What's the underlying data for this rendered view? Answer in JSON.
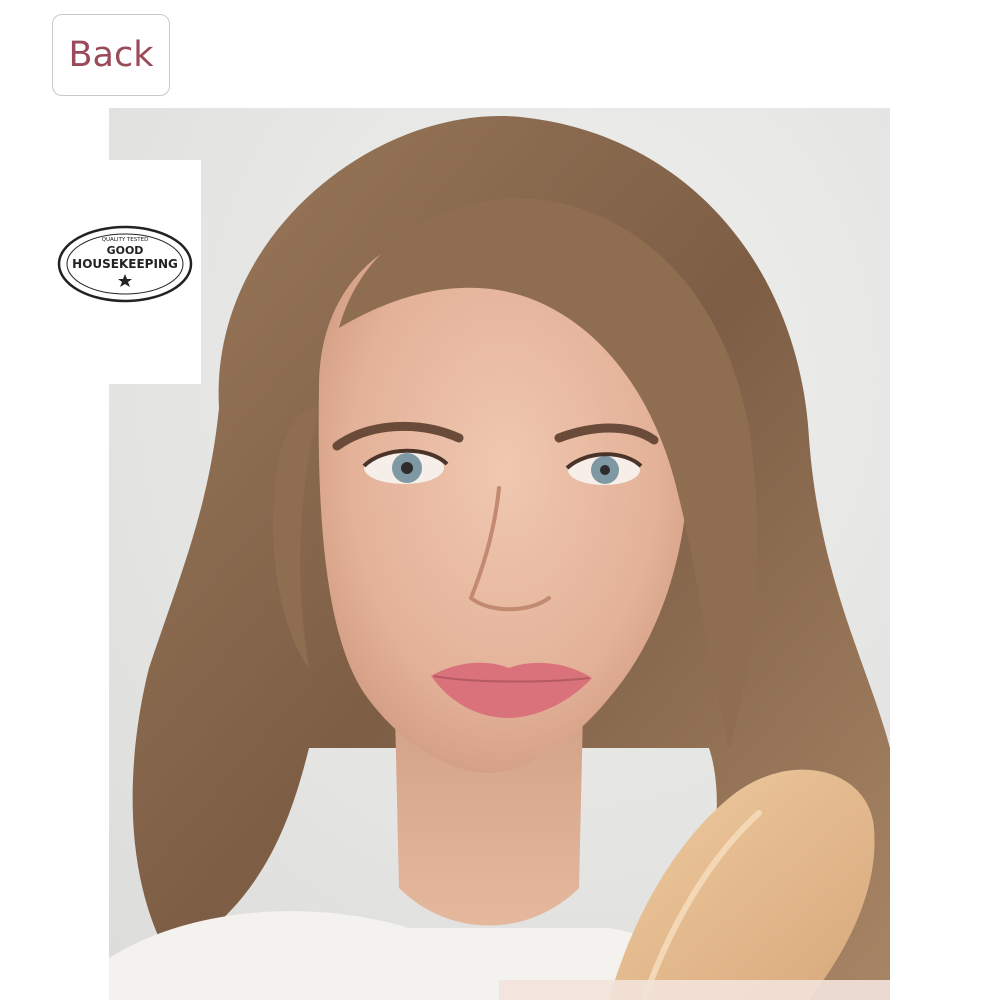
{
  "header": {
    "back_label": "Back"
  },
  "hero": {
    "subject": "model-portrait-with-foundation-swatch"
  },
  "badge": {
    "seal_text_top": "QUALITY TESTED",
    "seal_text_main_1": "GOOD",
    "seal_text_main_2": "HOUSEKEEPING"
  },
  "colors": {
    "back_text": "#9a4a58",
    "back_border": "#c9c9c9",
    "photo_background": "#e6e6e4",
    "hair": "#8a6a50",
    "skin": "#e6b9a0",
    "lips": "#d9727a",
    "foundation_swatch": "#e2b98e"
  },
  "icons": [
    "good-housekeeping-seal-icon"
  ]
}
